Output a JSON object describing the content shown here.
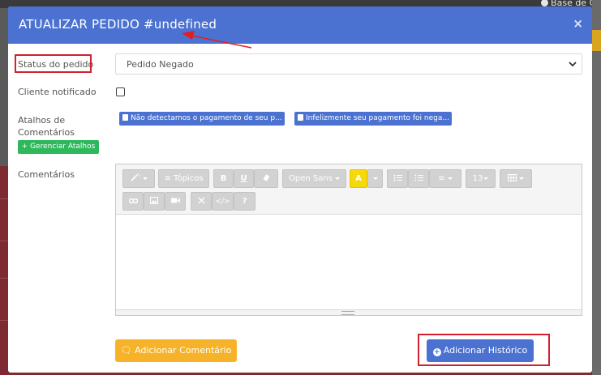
{
  "background": {
    "top_link": "Base de Co"
  },
  "modal": {
    "title": "ATUALIZAR PEDIDO #undefined",
    "close_label": "×"
  },
  "form": {
    "status_label": "Status do pedido",
    "status_value": "Pedido Negado",
    "notified_label": "Cliente notificado",
    "notified_checked": false,
    "shortcuts_label_line1": "Atalhos de",
    "shortcuts_label_line2": "Comentários",
    "manage_shortcuts_label": "Gerenciar Atalhos",
    "shortcuts": [
      {
        "label": "Não detectamos o pagamento de seu p..."
      },
      {
        "label": "Infelizmente seu pagamento foi nega..."
      }
    ],
    "comments_label": "Comentários"
  },
  "editor": {
    "toolbar": {
      "style": "",
      "paragraph": "Tópicos",
      "bold": "B",
      "underline": "U",
      "font_family": "Open Sans",
      "font_size": "13",
      "help": "?"
    }
  },
  "actions": {
    "add_comment": "Adicionar Comentário",
    "add_history": "Adicionar Histórico"
  },
  "colors": {
    "header": "#4b72d1",
    "annotation": "#d2202f",
    "add_comment": "#f6b32a",
    "manage": "#2eb85c"
  }
}
